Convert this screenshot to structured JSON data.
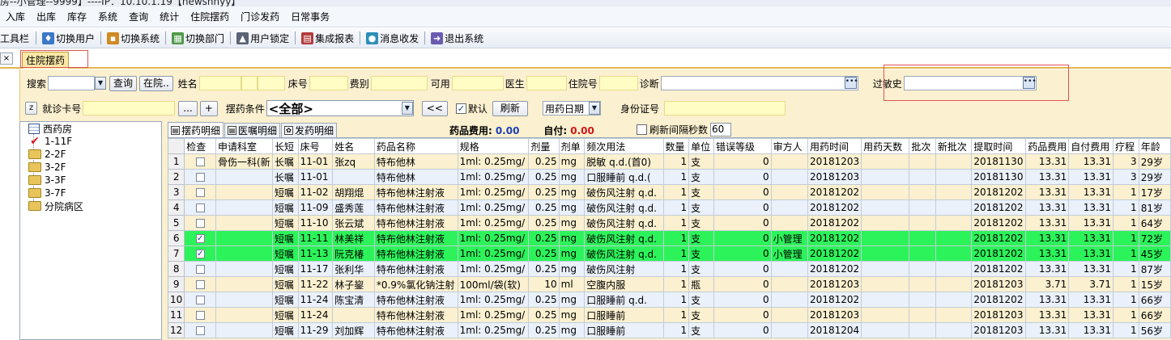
{
  "window": {
    "title": "房--小管理--9999】----IP：10.10.1.19【newshnyy】"
  },
  "menu": [
    "入库",
    "出库",
    "库存",
    "系统",
    "查询",
    "统计",
    "住院摆药",
    "门诊发药",
    "日常事务"
  ],
  "toolbar": {
    "label": "工具栏",
    "buttons": [
      {
        "label": "切换用户",
        "icon": "switch-user-icon"
      },
      {
        "label": "切换系统",
        "icon": "switch-system-icon"
      },
      {
        "label": "切换部门",
        "icon": "switch-dept-icon"
      },
      {
        "label": "用户锁定",
        "icon": "user-lock-icon"
      },
      {
        "label": "集成报表",
        "icon": "report-icon"
      },
      {
        "label": "消息收发",
        "icon": "message-icon"
      },
      {
        "label": "退出系统",
        "icon": "exit-icon"
      }
    ]
  },
  "tab": {
    "close": "×",
    "label": "住院摆药"
  },
  "filters": {
    "search_label": "搜索",
    "search_button": "查询",
    "inhosp_button": "在院..",
    "name_label": "姓名",
    "bed_label": "床号",
    "fee_type_label": "费别",
    "available_label": "可用",
    "doctor_label": "医生",
    "inpatient_label": "住院号",
    "diagnosis_label": "诊断",
    "allergy_label": "过敏史",
    "z_button": "z",
    "card_label": "就诊卡号",
    "ellipsis": "...",
    "plus": "+",
    "condition_label": "摆药条件",
    "condition_value": "<全部>",
    "prev_button": "<<",
    "default_label": "默认",
    "default_checked": true,
    "refresh_button": "刷新",
    "date_type": "用药日期",
    "id_label": "身份证号"
  },
  "tree": {
    "root": "西药房",
    "items": [
      "1-11F",
      "2-2F",
      "3-2F",
      "3-3F",
      "3-7F",
      "分院病区"
    ]
  },
  "subtabs": [
    "摆药明细",
    "医嘱明细",
    "发药明细"
  ],
  "costs": {
    "drug_label": "药品费用:",
    "drug_value": "0.00",
    "self_label": "自付:",
    "self_value": "0.00"
  },
  "refresh_interval": {
    "label": "刷新间隔秒数",
    "value": "60"
  },
  "table": {
    "headers": [
      "",
      "检查",
      "申请科室",
      "长短",
      "床号",
      "姓名",
      "药品名称",
      "规格",
      "剂量",
      "剂单",
      "频次用法",
      "数量",
      "单位",
      "错误等级",
      "审方人",
      "用药时间",
      "用药天数",
      "批次",
      "新批次",
      "提取时间",
      "药品费用",
      "自付费用",
      "疗程",
      "年龄"
    ],
    "rows": [
      {
        "n": "1",
        "checked": false,
        "dept": "骨伤一科(新",
        "type": "长嘱",
        "bed": "11-01",
        "name": "张zq",
        "drug": "特布他林",
        "spec": "1ml: 0.25mg/",
        "dose": "0.25",
        "unit1": "mg",
        "freq": "脱敏 q.d.(首0)",
        "qty": "1",
        "unit": "支",
        "err": "0",
        "reviewer": "",
        "time": "20181203",
        "days": "",
        "batch": "",
        "newbatch": "",
        "extract": "20181130",
        "fee": "13.31",
        "self": "13.31",
        "course": "3",
        "age": "29岁",
        "hl": false
      },
      {
        "n": "2",
        "checked": false,
        "dept": "",
        "type": "长嘱",
        "bed": "11-01",
        "name": "",
        "drug": "特布他林",
        "spec": "1ml: 0.25mg/",
        "dose": "0.25",
        "unit1": "mg",
        "freq": "口服睡前 q.d.(",
        "qty": "1",
        "unit": "支",
        "err": "0",
        "reviewer": "",
        "time": "20181203",
        "days": "",
        "batch": "",
        "newbatch": "",
        "extract": "20181130",
        "fee": "13.31",
        "self": "13.31",
        "course": "3",
        "age": "29岁",
        "hl": false
      },
      {
        "n": "3",
        "checked": false,
        "dept": "",
        "type": "短嘱",
        "bed": "11-02",
        "name": "胡翔焜",
        "drug": "特布他林注射液",
        "spec": "1ml: 0.25mg/",
        "dose": "0.25",
        "unit1": "mg",
        "freq": "破伤风注射 q.d.",
        "qty": "1",
        "unit": "支",
        "err": "0",
        "reviewer": "",
        "time": "20181202",
        "days": "",
        "batch": "",
        "newbatch": "",
        "extract": "20181202",
        "fee": "13.31",
        "self": "13.31",
        "course": "1",
        "age": "17岁",
        "hl": false
      },
      {
        "n": "4",
        "checked": false,
        "dept": "",
        "type": "短嘱",
        "bed": "11-09",
        "name": "盛秀莲",
        "drug": "特布他林注射液",
        "spec": "1ml: 0.25mg/",
        "dose": "0.25",
        "unit1": "mg",
        "freq": "破伤风注射 q.d.",
        "qty": "1",
        "unit": "支",
        "err": "0",
        "reviewer": "",
        "time": "20181202",
        "days": "",
        "batch": "",
        "newbatch": "",
        "extract": "20181202",
        "fee": "13.31",
        "self": "13.31",
        "course": "1",
        "age": "81岁",
        "hl": false
      },
      {
        "n": "5",
        "checked": false,
        "dept": "",
        "type": "短嘱",
        "bed": "11-10",
        "name": "张云斌",
        "drug": "特布他林注射液",
        "spec": "1ml: 0.25mg/",
        "dose": "0.25",
        "unit1": "mg",
        "freq": "破伤风注射 q.d.",
        "qty": "1",
        "unit": "支",
        "err": "0",
        "reviewer": "",
        "time": "20181202",
        "days": "",
        "batch": "",
        "newbatch": "",
        "extract": "20181202",
        "fee": "13.31",
        "self": "13.31",
        "course": "1",
        "age": "64岁",
        "hl": false
      },
      {
        "n": "6",
        "checked": true,
        "dept": "",
        "type": "短嘱",
        "bed": "11-11",
        "name": "林美祥",
        "drug": "特布他林注射液",
        "spec": "1ml: 0.25mg/",
        "dose": "0.25",
        "unit1": "mg",
        "freq": "破伤风注射 q.d.",
        "qty": "1",
        "unit": "支",
        "err": "0",
        "reviewer": "小管理",
        "time": "20181202",
        "days": "",
        "batch": "",
        "newbatch": "",
        "extract": "20181202",
        "fee": "13.31",
        "self": "13.31",
        "course": "1",
        "age": "72岁",
        "hl": true
      },
      {
        "n": "7",
        "checked": true,
        "dept": "",
        "type": "短嘱",
        "bed": "11-13",
        "name": "阮克椿",
        "drug": "特布他林注射液",
        "spec": "1ml: 0.25mg/",
        "dose": "0.25",
        "unit1": "mg",
        "freq": "破伤风注射 q.d.",
        "qty": "1",
        "unit": "支",
        "err": "0",
        "reviewer": "小管理",
        "time": "20181202",
        "days": "",
        "batch": "",
        "newbatch": "",
        "extract": "20181202",
        "fee": "13.31",
        "self": "13.31",
        "course": "1",
        "age": "45岁",
        "hl": true
      },
      {
        "n": "8",
        "checked": false,
        "dept": "",
        "type": "短嘱",
        "bed": "11-17",
        "name": "张利华",
        "drug": "特布他林注射液",
        "spec": "1ml: 0.25mg/",
        "dose": "0.25",
        "unit1": "mg",
        "freq": "破伤风注射",
        "qty": "1",
        "unit": "支",
        "err": "0",
        "reviewer": "",
        "time": "20181202",
        "days": "",
        "batch": "",
        "newbatch": "",
        "extract": "20181202",
        "fee": "13.31",
        "self": "13.31",
        "course": "1",
        "age": "87岁",
        "hl": false
      },
      {
        "n": "9",
        "checked": false,
        "dept": "",
        "type": "短嘱",
        "bed": "11-22",
        "name": "林子鋆",
        "drug": "*0.9%氯化钠注射",
        "spec": "100ml/袋(软)",
        "dose": "10",
        "unit1": "ml",
        "freq": "空腹内服",
        "qty": "1",
        "unit": "瓶",
        "err": "0",
        "reviewer": "",
        "time": "20181203",
        "days": "",
        "batch": "",
        "newbatch": "",
        "extract": "20181203",
        "fee": "3.71",
        "self": "3.71",
        "course": "1",
        "age": "15岁",
        "hl": false
      },
      {
        "n": "10",
        "checked": false,
        "dept": "",
        "type": "短嘱",
        "bed": "11-24",
        "name": "陈宝清",
        "drug": "特布他林注射液",
        "spec": "1ml: 0.25mg/",
        "dose": "0.25",
        "unit1": "mg",
        "freq": "口服睡前 q.d.",
        "qty": "1",
        "unit": "支",
        "err": "0",
        "reviewer": "",
        "time": "20181202",
        "days": "",
        "batch": "",
        "newbatch": "",
        "extract": "20181202",
        "fee": "13.31",
        "self": "13.31",
        "course": "1",
        "age": "66岁",
        "hl": false
      },
      {
        "n": "11",
        "checked": false,
        "dept": "",
        "type": "短嘱",
        "bed": "11-24",
        "name": "",
        "drug": "特布他林注射液",
        "spec": "1ml: 0.25mg/",
        "dose": "0.25",
        "unit1": "mg",
        "freq": "口服睡前",
        "qty": "1",
        "unit": "支",
        "err": "0",
        "reviewer": "",
        "time": "20181203",
        "days": "",
        "batch": "",
        "newbatch": "",
        "extract": "20181203",
        "fee": "13.31",
        "self": "13.31",
        "course": "1",
        "age": "66岁",
        "hl": false
      },
      {
        "n": "12",
        "checked": false,
        "dept": "",
        "type": "短嘱",
        "bed": "11-29",
        "name": "刘加辉",
        "drug": "特布他林注射液",
        "spec": "1ml: 0.25mg/",
        "dose": "0.25",
        "unit1": "mg",
        "freq": "口服睡前",
        "qty": "1",
        "unit": "支",
        "err": "0",
        "reviewer": "",
        "time": "20181204",
        "days": "",
        "batch": "",
        "newbatch": "",
        "extract": "20181203",
        "fee": "13.31",
        "self": "13.31",
        "course": "1",
        "age": "56岁",
        "hl": false
      }
    ]
  }
}
